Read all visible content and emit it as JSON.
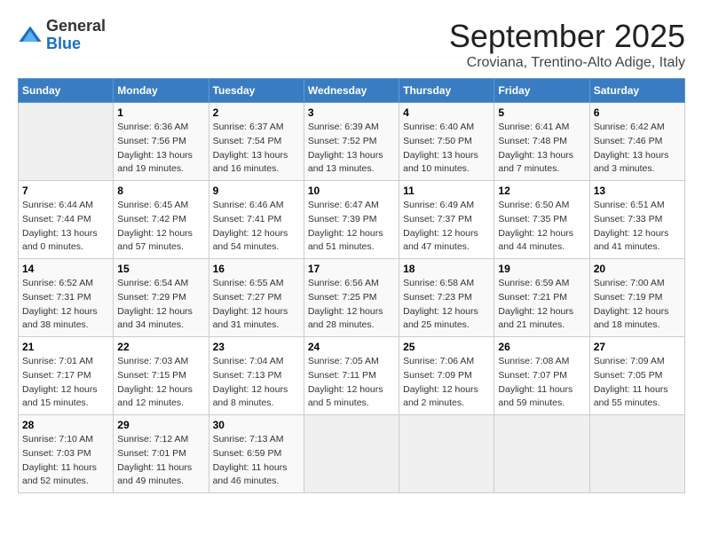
{
  "header": {
    "logo_general": "General",
    "logo_blue": "Blue",
    "month_year": "September 2025",
    "location": "Croviana, Trentino-Alto Adige, Italy"
  },
  "days_of_week": [
    "Sunday",
    "Monday",
    "Tuesday",
    "Wednesday",
    "Thursday",
    "Friday",
    "Saturday"
  ],
  "weeks": [
    [
      {
        "day": "",
        "info": ""
      },
      {
        "day": "1",
        "info": "Sunrise: 6:36 AM\nSunset: 7:56 PM\nDaylight: 13 hours\nand 19 minutes."
      },
      {
        "day": "2",
        "info": "Sunrise: 6:37 AM\nSunset: 7:54 PM\nDaylight: 13 hours\nand 16 minutes."
      },
      {
        "day": "3",
        "info": "Sunrise: 6:39 AM\nSunset: 7:52 PM\nDaylight: 13 hours\nand 13 minutes."
      },
      {
        "day": "4",
        "info": "Sunrise: 6:40 AM\nSunset: 7:50 PM\nDaylight: 13 hours\nand 10 minutes."
      },
      {
        "day": "5",
        "info": "Sunrise: 6:41 AM\nSunset: 7:48 PM\nDaylight: 13 hours\nand 7 minutes."
      },
      {
        "day": "6",
        "info": "Sunrise: 6:42 AM\nSunset: 7:46 PM\nDaylight: 13 hours\nand 3 minutes."
      }
    ],
    [
      {
        "day": "7",
        "info": "Sunrise: 6:44 AM\nSunset: 7:44 PM\nDaylight: 13 hours\nand 0 minutes."
      },
      {
        "day": "8",
        "info": "Sunrise: 6:45 AM\nSunset: 7:42 PM\nDaylight: 12 hours\nand 57 minutes."
      },
      {
        "day": "9",
        "info": "Sunrise: 6:46 AM\nSunset: 7:41 PM\nDaylight: 12 hours\nand 54 minutes."
      },
      {
        "day": "10",
        "info": "Sunrise: 6:47 AM\nSunset: 7:39 PM\nDaylight: 12 hours\nand 51 minutes."
      },
      {
        "day": "11",
        "info": "Sunrise: 6:49 AM\nSunset: 7:37 PM\nDaylight: 12 hours\nand 47 minutes."
      },
      {
        "day": "12",
        "info": "Sunrise: 6:50 AM\nSunset: 7:35 PM\nDaylight: 12 hours\nand 44 minutes."
      },
      {
        "day": "13",
        "info": "Sunrise: 6:51 AM\nSunset: 7:33 PM\nDaylight: 12 hours\nand 41 minutes."
      }
    ],
    [
      {
        "day": "14",
        "info": "Sunrise: 6:52 AM\nSunset: 7:31 PM\nDaylight: 12 hours\nand 38 minutes."
      },
      {
        "day": "15",
        "info": "Sunrise: 6:54 AM\nSunset: 7:29 PM\nDaylight: 12 hours\nand 34 minutes."
      },
      {
        "day": "16",
        "info": "Sunrise: 6:55 AM\nSunset: 7:27 PM\nDaylight: 12 hours\nand 31 minutes."
      },
      {
        "day": "17",
        "info": "Sunrise: 6:56 AM\nSunset: 7:25 PM\nDaylight: 12 hours\nand 28 minutes."
      },
      {
        "day": "18",
        "info": "Sunrise: 6:58 AM\nSunset: 7:23 PM\nDaylight: 12 hours\nand 25 minutes."
      },
      {
        "day": "19",
        "info": "Sunrise: 6:59 AM\nSunset: 7:21 PM\nDaylight: 12 hours\nand 21 minutes."
      },
      {
        "day": "20",
        "info": "Sunrise: 7:00 AM\nSunset: 7:19 PM\nDaylight: 12 hours\nand 18 minutes."
      }
    ],
    [
      {
        "day": "21",
        "info": "Sunrise: 7:01 AM\nSunset: 7:17 PM\nDaylight: 12 hours\nand 15 minutes."
      },
      {
        "day": "22",
        "info": "Sunrise: 7:03 AM\nSunset: 7:15 PM\nDaylight: 12 hours\nand 12 minutes."
      },
      {
        "day": "23",
        "info": "Sunrise: 7:04 AM\nSunset: 7:13 PM\nDaylight: 12 hours\nand 8 minutes."
      },
      {
        "day": "24",
        "info": "Sunrise: 7:05 AM\nSunset: 7:11 PM\nDaylight: 12 hours\nand 5 minutes."
      },
      {
        "day": "25",
        "info": "Sunrise: 7:06 AM\nSunset: 7:09 PM\nDaylight: 12 hours\nand 2 minutes."
      },
      {
        "day": "26",
        "info": "Sunrise: 7:08 AM\nSunset: 7:07 PM\nDaylight: 11 hours\nand 59 minutes."
      },
      {
        "day": "27",
        "info": "Sunrise: 7:09 AM\nSunset: 7:05 PM\nDaylight: 11 hours\nand 55 minutes."
      }
    ],
    [
      {
        "day": "28",
        "info": "Sunrise: 7:10 AM\nSunset: 7:03 PM\nDaylight: 11 hours\nand 52 minutes."
      },
      {
        "day": "29",
        "info": "Sunrise: 7:12 AM\nSunset: 7:01 PM\nDaylight: 11 hours\nand 49 minutes."
      },
      {
        "day": "30",
        "info": "Sunrise: 7:13 AM\nSunset: 6:59 PM\nDaylight: 11 hours\nand 46 minutes."
      },
      {
        "day": "",
        "info": ""
      },
      {
        "day": "",
        "info": ""
      },
      {
        "day": "",
        "info": ""
      },
      {
        "day": "",
        "info": ""
      }
    ]
  ]
}
